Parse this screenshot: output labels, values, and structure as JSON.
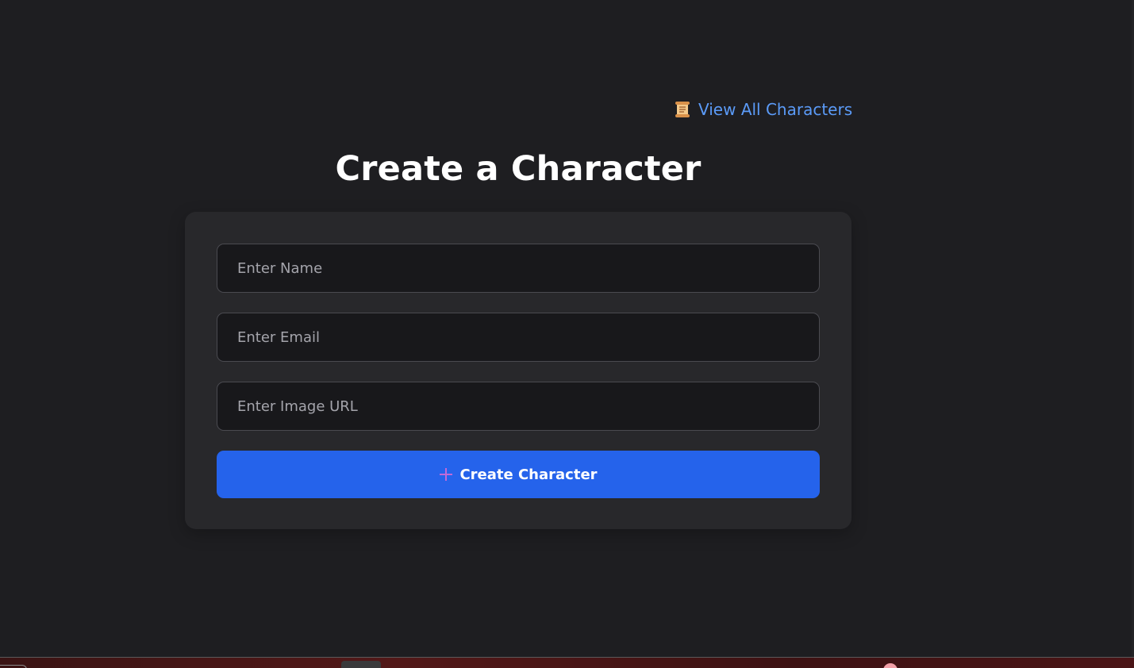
{
  "nav": {
    "view_all_label": "View All Characters",
    "view_all_icon": "scroll-icon"
  },
  "title": "Create a Character",
  "form": {
    "name_placeholder": "Enter Name",
    "email_placeholder": "Enter Email",
    "image_url_placeholder": "Enter Image URL",
    "name_value": "",
    "email_value": "",
    "image_url_value": "",
    "submit_label": "Create Character",
    "submit_icon": "plus-icon"
  },
  "colors": {
    "background": "#1e1e21",
    "card": "#28282b",
    "input_bg": "#18181b",
    "accent": "#2563eb",
    "link": "#5b9bf8"
  }
}
